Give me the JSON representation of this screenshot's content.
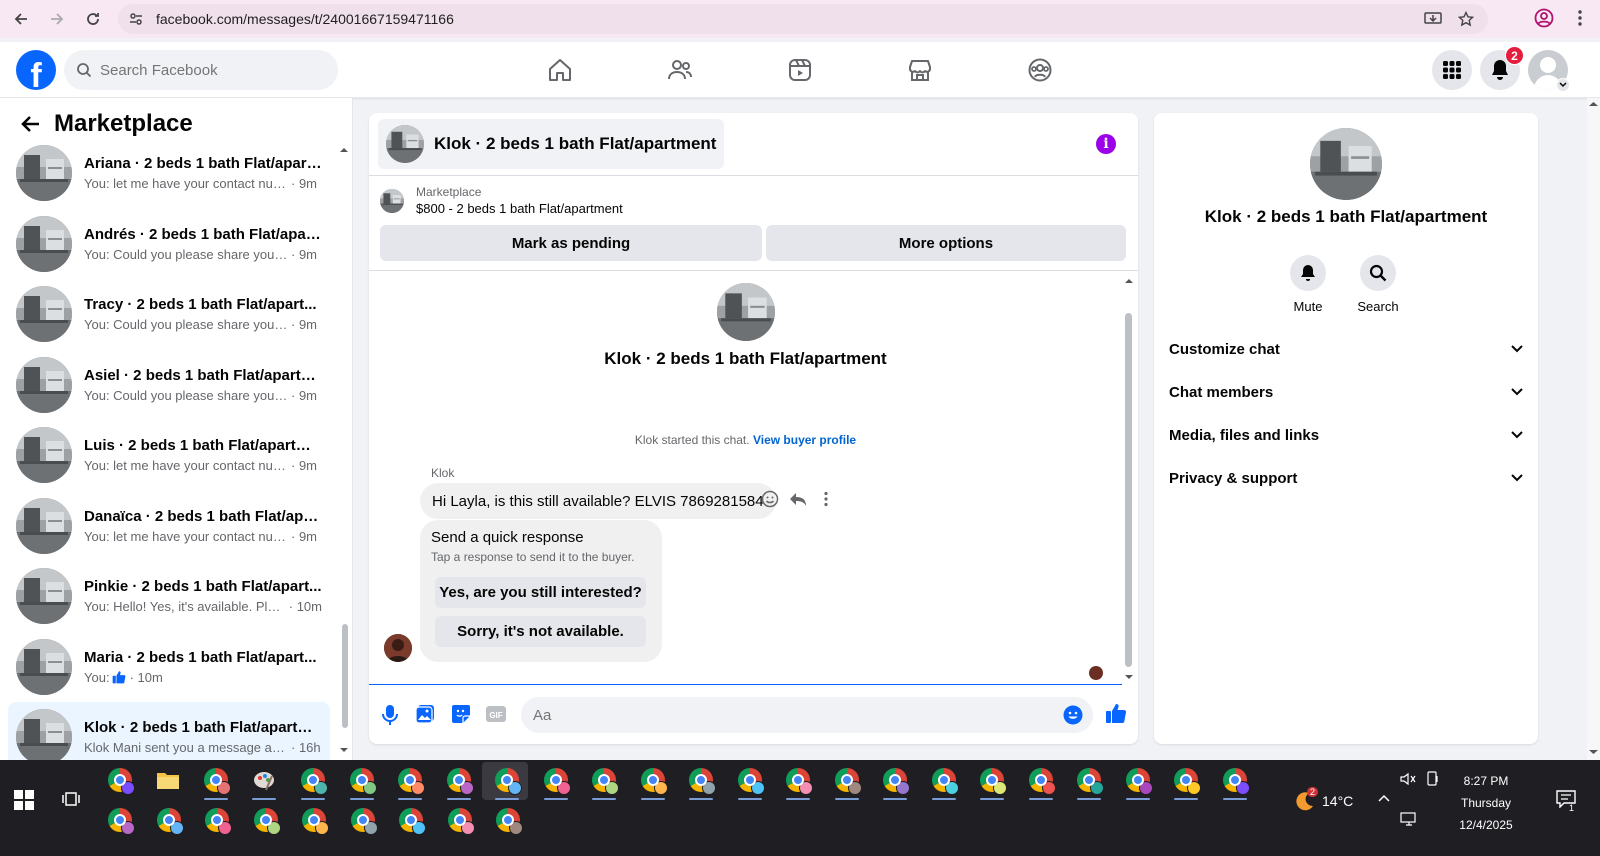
{
  "browser": {
    "url": "facebook.com/messages/t/24001667159471166"
  },
  "header": {
    "logo_letter": "f",
    "search_placeholder": "Search Facebook",
    "notifications_count": "2",
    "nav": [
      "home-icon",
      "friends-icon",
      "video-icon",
      "marketplace-icon",
      "groups-icon"
    ]
  },
  "sidebar": {
    "title": "Marketplace",
    "chats": [
      {
        "name": "Ariana · 2 beds 1 bath Flat/apart...",
        "preview": "You: let me have your contact num...",
        "time": "· 9m"
      },
      {
        "name": "Andrés · 2 beds 1 bath Flat/apart...",
        "preview": "You: Could you please share your c...",
        "time": "· 9m"
      },
      {
        "name": "Tracy · 2 beds 1 bath Flat/apart...",
        "preview": "You: Could you please share your c...",
        "time": "· 9m"
      },
      {
        "name": "Asiel · 2 beds 1 bath Flat/apartm...",
        "preview": "You: Could you please share your c...",
        "time": "· 9m"
      },
      {
        "name": "Luis · 2 beds 1 bath Flat/apartme...",
        "preview": "You: let me have your contact num...",
        "time": "· 9m"
      },
      {
        "name": "Danaïca · 2 beds 1 bath Flat/apa...",
        "preview": "You: let me have your contact num...",
        "time": "· 9m"
      },
      {
        "name": "Pinkie · 2 beds 1 bath Flat/apart...",
        "preview": "You: Hello! Yes, it's available. Plea...",
        "time": "· 10m"
      },
      {
        "name": "Maria · 2 beds 1 bath Flat/apart...",
        "preview": "You: ",
        "time": "· 10m"
      },
      {
        "name": "Klok · 2 beds 1 bath Flat/apartm...",
        "preview": "Klok Mani sent you a message ab...",
        "time": "· 16h"
      }
    ]
  },
  "conversation": {
    "title": "Klok · 2 beds 1 bath Flat/apartment",
    "listing_label": "Marketplace",
    "listing_price": "$800 - 2 beds 1 bath Flat/apartment",
    "mark_pending": "Mark as pending",
    "more_options": "More options",
    "center_name": "Klok · 2 beds 1 bath Flat/apartment",
    "started_text": "Klok started this chat.",
    "view_buyer": "View buyer profile",
    "sender": "Klok",
    "message": "Hi Layla, is this still available? ELVIS 7869281584",
    "quick_title": "Send a quick response",
    "quick_sub": "Tap a response to send it to the buyer.",
    "quick_1": "Yes, are you still interested?",
    "quick_2": "Sorry, it's not available.",
    "composer_placeholder": "Aa"
  },
  "details": {
    "name": "Klok · 2 beds 1 bath Flat/apartment",
    "mute": "Mute",
    "search": "Search",
    "sections": [
      "Customize chat",
      "Chat members",
      "Media, files and links",
      "Privacy & support"
    ]
  },
  "taskbar": {
    "temperature": "14°C",
    "weather_badge": "2",
    "time": "8:27 PM",
    "day": "Thursday",
    "date": "12/4/2025",
    "notif_count": "1"
  },
  "colors": {
    "fb_blue": "#0866ff",
    "info_purple": "#9b00e8",
    "badge_red": "#e41e3f"
  }
}
